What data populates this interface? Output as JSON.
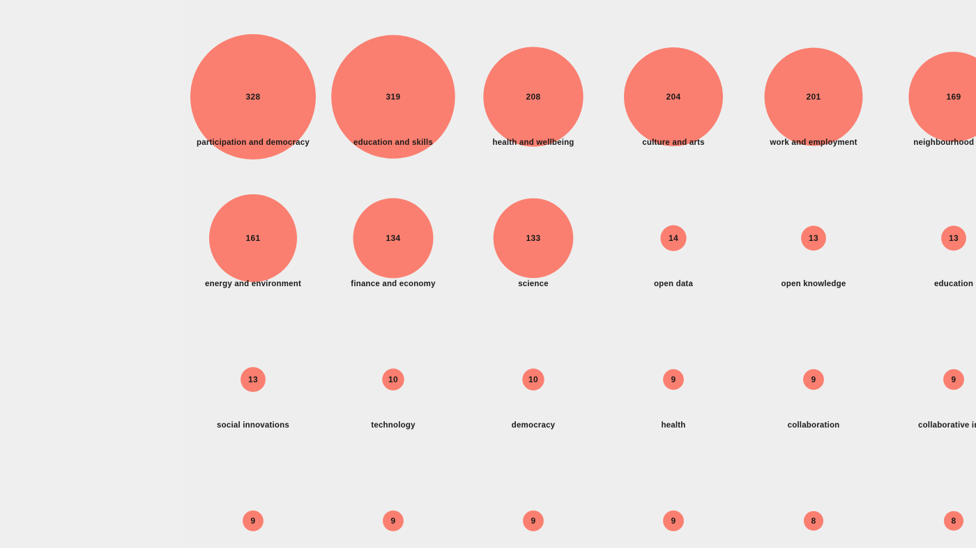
{
  "chart_data": {
    "type": "bubble",
    "color": "#fa7f70",
    "background": "#eeeeee",
    "items": [
      {
        "label": "participation and democracy",
        "value": 328
      },
      {
        "label": "education and skills",
        "value": 319
      },
      {
        "label": "health and wellbeing",
        "value": 208
      },
      {
        "label": "culture and arts",
        "value": 204
      },
      {
        "label": "work and employment",
        "value": 201
      },
      {
        "label": "neighbourhood rege",
        "value": 169
      },
      {
        "label": "energy and environment",
        "value": 161
      },
      {
        "label": "finance and economy",
        "value": 134
      },
      {
        "label": "science",
        "value": 133
      },
      {
        "label": "open data",
        "value": 14
      },
      {
        "label": "open knowledge",
        "value": 13
      },
      {
        "label": "education",
        "value": 13
      },
      {
        "label": "social innovations",
        "value": 13
      },
      {
        "label": "technology",
        "value": 10
      },
      {
        "label": "democracy",
        "value": 10
      },
      {
        "label": "health",
        "value": 9
      },
      {
        "label": "collaboration",
        "value": 9
      },
      {
        "label": "collaborative inno",
        "value": 9
      },
      {
        "label": "",
        "value": 9
      },
      {
        "label": "",
        "value": 9
      },
      {
        "label": "",
        "value": 9
      },
      {
        "label": "",
        "value": 9
      },
      {
        "label": "",
        "value": 8
      },
      {
        "label": "",
        "value": 8
      }
    ]
  }
}
